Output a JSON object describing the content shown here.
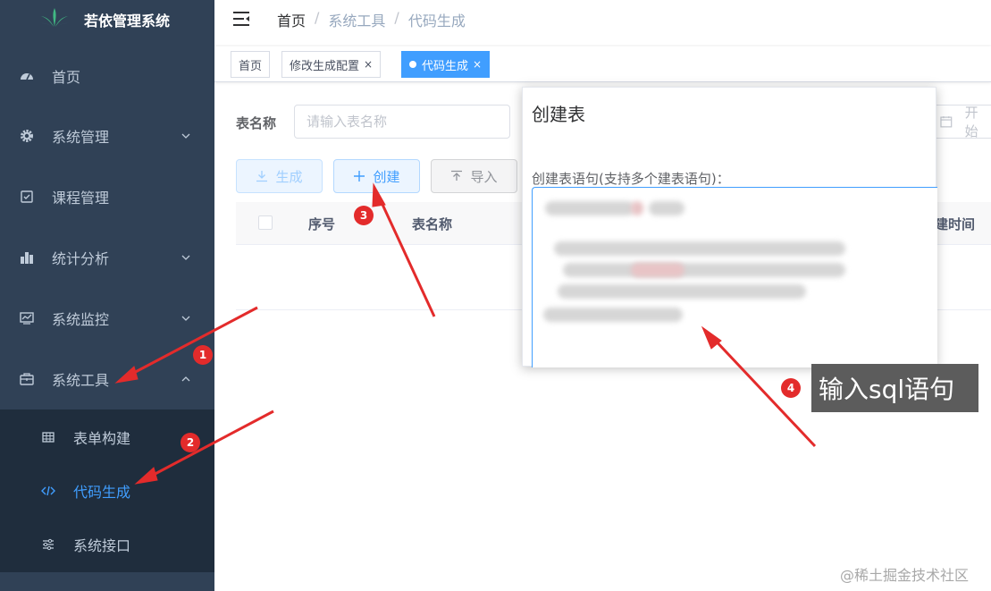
{
  "app": {
    "title": "若依管理系统"
  },
  "sidebar": {
    "items": [
      {
        "label": "首页",
        "icon": "dashboard-icon"
      },
      {
        "label": "系统管理",
        "icon": "gear-icon"
      },
      {
        "label": "课程管理",
        "icon": "checkbox-icon"
      },
      {
        "label": "统计分析",
        "icon": "bar-chart-icon"
      },
      {
        "label": "系统监控",
        "icon": "monitor-icon"
      },
      {
        "label": "系统工具",
        "icon": "toolbox-icon"
      }
    ],
    "submenu": [
      {
        "label": "表单构建",
        "icon": "table-icon"
      },
      {
        "label": "代码生成",
        "icon": "code-icon",
        "active": true
      },
      {
        "label": "系统接口",
        "icon": "sliders-icon"
      }
    ]
  },
  "breadcrumb": {
    "home": "首页",
    "sep": "/",
    "level1": "系统工具",
    "level2": "代码生成"
  },
  "tags": [
    {
      "label": "首页"
    },
    {
      "label": "修改生成配置",
      "close": "×"
    },
    {
      "label": "代码生成",
      "close": "×",
      "active": true
    }
  ],
  "search": {
    "label": "表名称",
    "placeholder": "请输入表名称",
    "date_placeholder": "开始"
  },
  "toolbar": {
    "generate_label": "生成",
    "create_label": "创建",
    "import_label": "导入"
  },
  "table": {
    "headers": [
      "序号",
      "表名称",
      "建时间"
    ]
  },
  "dialog": {
    "title": "创建表",
    "textarea_label": "创建表语句(支持多个建表语句)："
  },
  "annotations": {
    "badges": [
      "1",
      "2",
      "3",
      "4"
    ],
    "callout": "输入sql语句",
    "arrow_color": "#e32b2b"
  },
  "watermark": "@稀土掘金技术社区",
  "colors": {
    "sidebar": "#304156",
    "submenu": "#1f2d3d",
    "primary": "#409eff",
    "logo": "#41b883"
  }
}
